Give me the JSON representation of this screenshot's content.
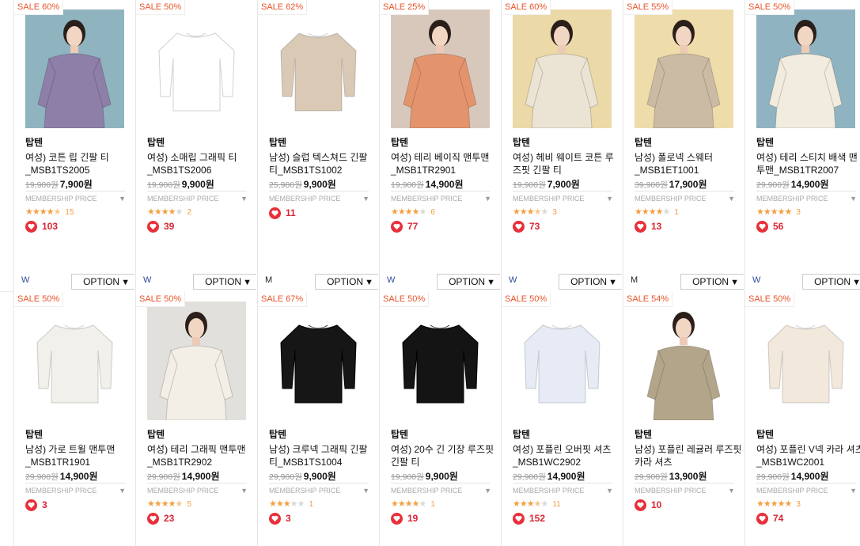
{
  "products": [
    {
      "sale": "SALE 60%",
      "brand": "탑텐",
      "name": "여성) 코튼 립 긴팔 티 _MSB1TS2005",
      "orig": "19,900원",
      "price": "7,900원",
      "membership": "MEMBERSHIP PRICE",
      "rating": 4.5,
      "reviews": "15",
      "likes": "103",
      "gender": "W",
      "option": "OPTION",
      "color": "#8e7fa8",
      "style": "model"
    },
    {
      "sale": "SALE 50%",
      "brand": "탑텐",
      "name": "여성) 소매립 그래픽 티 _MSB1TS2006",
      "orig": "19,900원",
      "price": "9,900원",
      "membership": "MEMBERSHIP PRICE",
      "rating": 4,
      "reviews": "2",
      "likes": "39",
      "gender": "W",
      "option": "OPTION",
      "color": "#ffffff",
      "style": "flat"
    },
    {
      "sale": "SALE 62%",
      "brand": "탑텐",
      "name": "남성) 슬럽 텍스쳐드 긴팔 티_MSB1TS1002",
      "orig": "25,900원",
      "price": "9,900원",
      "membership": "MEMBERSHIP PRICE",
      "rating": null,
      "reviews": "",
      "likes": "11",
      "gender": "M",
      "option": "OPTION",
      "color": "#d9c9b5",
      "style": "flat"
    },
    {
      "sale": "SALE 25%",
      "brand": "탑텐",
      "name": "여성) 테리 베이직 맨투맨_MSB1TR2901",
      "orig": "19,900원",
      "price": "14,900원",
      "membership": "MEMBERSHIP PRICE",
      "rating": 4,
      "reviews": "6",
      "likes": "77",
      "gender": "W",
      "option": "OPTION",
      "color": "#e4946c",
      "style": "model"
    },
    {
      "sale": "SALE 60%",
      "brand": "탑텐",
      "name": "여성) 헤비 웨이트 코튼 루즈핏 긴팔 티",
      "orig": "19,900원",
      "price": "7,900원",
      "membership": "MEMBERSHIP PRICE",
      "rating": 3.5,
      "reviews": "3",
      "likes": "73",
      "gender": "W",
      "option": "OPTION",
      "color": "#ebe3d3",
      "style": "model"
    },
    {
      "sale": "SALE 55%",
      "brand": "탑텐",
      "name": "남성) 폴로넥 스웨터 _MSB1ET1001",
      "orig": "39,900원",
      "price": "17,900원",
      "membership": "MEMBERSHIP PRICE",
      "rating": 4,
      "reviews": "1",
      "likes": "13",
      "gender": "M",
      "option": "OPTION",
      "color": "#ccbba4",
      "style": "model"
    },
    {
      "sale": "SALE 50%",
      "brand": "탑텐",
      "name": "여성) 테리 스티치 배색 맨투맨_MSB1TR2007",
      "orig": "29,900원",
      "price": "14,900원",
      "membership": "MEMBERSHIP PRICE",
      "rating": 5,
      "reviews": "3",
      "likes": "56",
      "gender": "W",
      "option": "OPTION",
      "color": "#f1ecdd",
      "style": "model"
    },
    {
      "sale": "SALE 50%",
      "brand": "탑텐",
      "name": "남성) 가로 트윌 맨투맨 _MSB1TR1901",
      "orig": "29,900원",
      "price": "14,900원",
      "membership": "MEMBERSHIP PRICE",
      "rating": null,
      "reviews": "",
      "likes": "3",
      "gender": "",
      "option": "",
      "color": "#f2f0ea",
      "style": "flat"
    },
    {
      "sale": "SALE 50%",
      "brand": "탑텐",
      "name": "여성) 테리 그래픽 맨투맨 _MSB1TR2902",
      "orig": "29,900원",
      "price": "14,900원",
      "membership": "MEMBERSHIP PRICE",
      "rating": 4.5,
      "reviews": "5",
      "likes": "23",
      "gender": "",
      "option": "",
      "color": "#f3efe6",
      "style": "model"
    },
    {
      "sale": "SALE 67%",
      "brand": "탑텐",
      "name": "남성) 크루넥 그래픽 긴팔 티_MSB1TS1004",
      "orig": "29,900원",
      "price": "9,900원",
      "membership": "MEMBERSHIP PRICE",
      "rating": 3,
      "reviews": "1",
      "likes": "3",
      "gender": "",
      "option": "",
      "color": "#161616",
      "style": "flat"
    },
    {
      "sale": "SALE 50%",
      "brand": "탑텐",
      "name": "여성) 20수 긴 기장 루즈핏 긴팔 티",
      "orig": "19,900원",
      "price": "9,900원",
      "membership": "MEMBERSHIP PRICE",
      "rating": 4,
      "reviews": "1",
      "likes": "19",
      "gender": "",
      "option": "",
      "color": "#141414",
      "style": "flat"
    },
    {
      "sale": "SALE 50%",
      "brand": "탑텐",
      "name": "여성) 포플린 오버핏 셔츠_MSB1WC2902",
      "orig": "29,900원",
      "price": "14,900원",
      "membership": "MEMBERSHIP PRICE",
      "rating": 3.5,
      "reviews": "11",
      "likes": "152",
      "gender": "",
      "option": "",
      "color": "#e6ebf5",
      "style": "flat"
    },
    {
      "sale": "SALE 54%",
      "brand": "탑텐",
      "name": "남성) 포플린 레귤러 루즈핏 카라 셔츠",
      "orig": "29,900원",
      "price": "13,900원",
      "membership": "MEMBERSHIP PRICE",
      "rating": null,
      "reviews": "",
      "likes": "10",
      "gender": "",
      "option": "",
      "color": "#b3a58a",
      "style": "model"
    },
    {
      "sale": "SALE 50%",
      "brand": "탑텐",
      "name": "여성) 포플린 V넥 카라 셔츠_MSB1WC2001",
      "orig": "29,900원",
      "price": "14,900원",
      "membership": "MEMBERSHIP PRICE",
      "rating": 5,
      "reviews": "3",
      "likes": "74",
      "gender": "",
      "option": "",
      "color": "#f3e8dc",
      "style": "flat"
    }
  ]
}
